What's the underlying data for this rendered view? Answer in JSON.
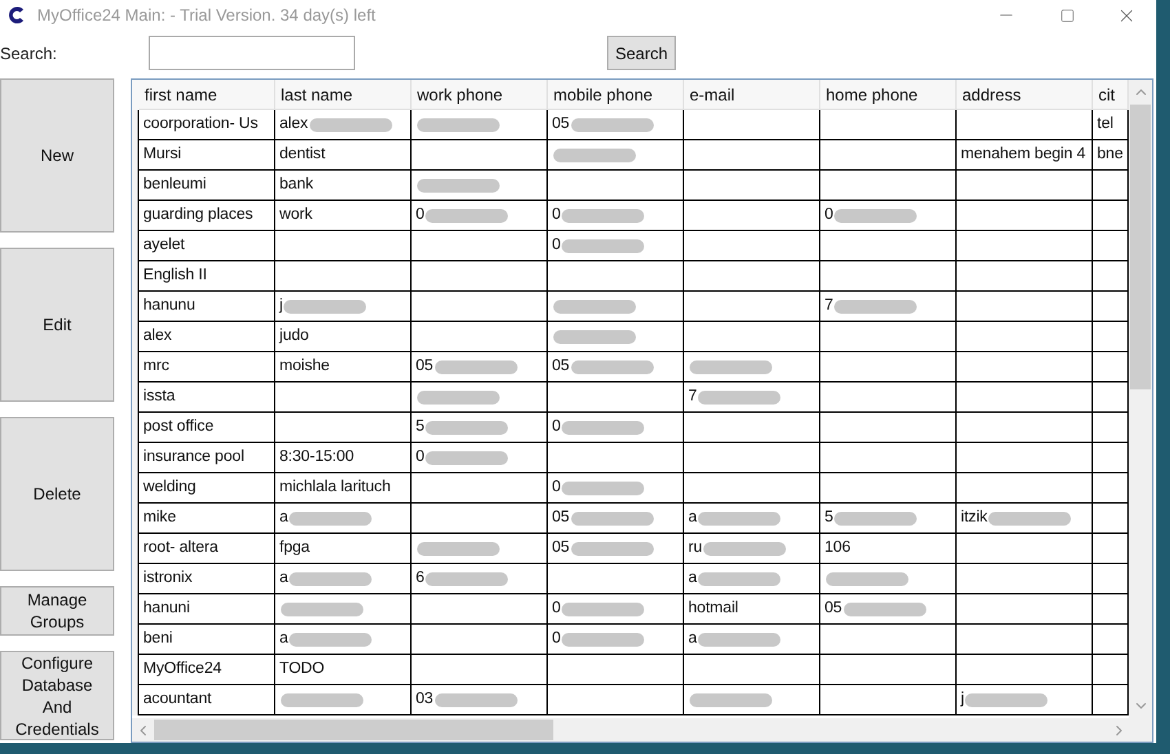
{
  "window": {
    "title": "MyOffice24 Main: - Trial Version. 34 day(s) left"
  },
  "search": {
    "label": "Search:",
    "button": "Search"
  },
  "side_buttons": [
    "New",
    "Edit",
    "Delete",
    "Manage Groups",
    "Configure Database And Credentials"
  ],
  "table": {
    "columns": [
      "first name",
      "last name",
      "work phone",
      "mobile phone",
      "e-mail",
      "home phone",
      "address",
      "cit"
    ],
    "rows": [
      [
        {
          "text": "coorporation-  Us"
        },
        {
          "text": "alex",
          "redacted": true
        },
        {
          "redacted": true
        },
        {
          "text": "05",
          "redacted": true
        },
        {},
        {},
        {},
        {
          "text": "tel"
        }
      ],
      [
        {
          "text": "Mursi"
        },
        {
          "text": "dentist"
        },
        {},
        {
          "redacted": true
        },
        {},
        {},
        {
          "text": "menahem begin 4"
        },
        {
          "text": "bne"
        }
      ],
      [
        {
          "text": "benleumi"
        },
        {
          "text": "bank"
        },
        {
          "redacted": true
        },
        {},
        {},
        {},
        {},
        {}
      ],
      [
        {
          "text": "guarding places"
        },
        {
          "text": "work"
        },
        {
          "text": "0",
          "redacted": true
        },
        {
          "text": "0",
          "redacted": true
        },
        {},
        {
          "text": "0",
          "redacted": true
        },
        {},
        {}
      ],
      [
        {
          "text": "ayelet"
        },
        {},
        {},
        {
          "text": "0",
          "redacted": true
        },
        {},
        {},
        {},
        {}
      ],
      [
        {
          "text": "English II"
        },
        {},
        {},
        {},
        {},
        {},
        {},
        {}
      ],
      [
        {
          "text": "hanunu"
        },
        {
          "text": "j",
          "redacted": true
        },
        {},
        {
          "redacted": true
        },
        {},
        {
          "text": "7",
          "redacted": true
        },
        {},
        {}
      ],
      [
        {
          "text": "alex"
        },
        {
          "text": "judo"
        },
        {},
        {
          "redacted": true
        },
        {},
        {},
        {},
        {}
      ],
      [
        {
          "text": "mrc"
        },
        {
          "text": "moishe"
        },
        {
          "text": "05",
          "redacted": true
        },
        {
          "text": "05",
          "redacted": true
        },
        {
          "redacted": true
        },
        {},
        {},
        {}
      ],
      [
        {
          "text": "issta"
        },
        {},
        {
          "redacted": true
        },
        {},
        {
          "text": "7",
          "redacted": true
        },
        {},
        {},
        {}
      ],
      [
        {
          "text": "post office"
        },
        {},
        {
          "text": "5",
          "redacted": true
        },
        {
          "text": "0",
          "redacted": true
        },
        {},
        {},
        {},
        {}
      ],
      [
        {
          "text": "insurance pool"
        },
        {
          "text": "8:30-15:00"
        },
        {
          "text": "0",
          "redacted": true
        },
        {},
        {},
        {},
        {},
        {}
      ],
      [
        {
          "text": "welding"
        },
        {
          "text": "michlala larituch"
        },
        {},
        {
          "text": "0",
          "redacted": true
        },
        {},
        {},
        {},
        {}
      ],
      [
        {
          "text": "mike"
        },
        {
          "text": "a",
          "redacted": true
        },
        {},
        {
          "text": "05",
          "redacted": true
        },
        {
          "text": "a",
          "redacted": true
        },
        {
          "text": "5",
          "redacted": true
        },
        {
          "text": "itzik",
          "redacted": true
        },
        {}
      ],
      [
        {
          "text": "root- altera"
        },
        {
          "text": "fpga"
        },
        {
          "redacted": true
        },
        {
          "text": "05",
          "redacted": true
        },
        {
          "text": "ru",
          "redacted": true
        },
        {
          "text": "106"
        },
        {},
        {}
      ],
      [
        {
          "text": "istronix"
        },
        {
          "text": "a",
          "redacted": true
        },
        {
          "text": "6",
          "redacted": true
        },
        {},
        {
          "text": "a",
          "redacted": true
        },
        {
          "redacted": true
        },
        {},
        {}
      ],
      [
        {
          "text": "hanuni"
        },
        {
          "redacted": true
        },
        {},
        {
          "text": "0",
          "redacted": true
        },
        {
          "text": "hotmail"
        },
        {
          "text": "05",
          "redacted": true
        },
        {},
        {}
      ],
      [
        {
          "text": "beni"
        },
        {
          "text": "a",
          "redacted": true
        },
        {},
        {
          "text": "0",
          "redacted": true
        },
        {
          "text": "a",
          "redacted": true
        },
        {},
        {},
        {}
      ],
      [
        {
          "text": "MyOffice24"
        },
        {
          "text": "TODO"
        },
        {},
        {},
        {},
        {},
        {},
        {}
      ],
      [
        {
          "text": "acountant"
        },
        {
          "redacted": true
        },
        {
          "text": "03",
          "redacted": true
        },
        {},
        {
          "redacted": true
        },
        {},
        {
          "text": "j",
          "redacted": true
        },
        {}
      ]
    ]
  }
}
